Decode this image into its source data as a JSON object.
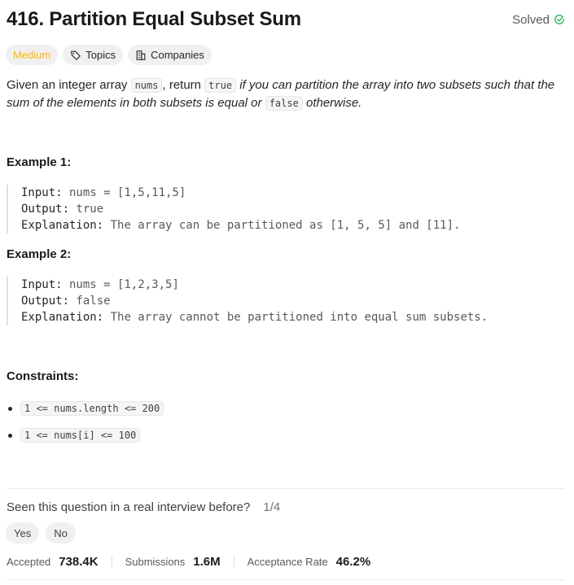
{
  "problem": {
    "title": "416. Partition Equal Subset Sum",
    "status": "Solved",
    "tags": {
      "difficulty": "Medium",
      "topics": "Topics",
      "companies": "Companies"
    }
  },
  "description": {
    "p1": "Given an integer array ",
    "code_nums": "nums",
    "p2": ", return ",
    "code_true": "true",
    "p3_italic": " if you can partition the array into two subsets such that the sum of the elements in both subsets is equal or ",
    "code_false": "false",
    "p4_italic": " otherwise."
  },
  "examples": [
    {
      "heading": "Example 1:",
      "input_label": "Input:",
      "input_value": " nums = [1,5,11,5]",
      "output_label": "Output:",
      "output_value": " true",
      "explanation_label": "Explanation:",
      "explanation_value": " The array can be partitioned as [1, 5, 5] and [11]."
    },
    {
      "heading": "Example 2:",
      "input_label": "Input:",
      "input_value": " nums = [1,2,3,5]",
      "output_label": "Output:",
      "output_value": " false",
      "explanation_label": "Explanation:",
      "explanation_value": " The array cannot be partitioned into equal sum subsets."
    }
  ],
  "constraints": {
    "heading": "Constraints:",
    "items": [
      "1 <= nums.length <= 200",
      "1 <= nums[i] <= 100"
    ]
  },
  "interview": {
    "question": "Seen this question in a real interview before?",
    "count": "1/4",
    "yes_label": "Yes",
    "no_label": "No"
  },
  "stats": {
    "accepted_label": "Accepted",
    "accepted_value": "738.4K",
    "submissions_label": "Submissions",
    "submissions_value": "1.6M",
    "rate_label": "Acceptance Rate",
    "rate_value": "46.2%"
  },
  "colors": {
    "medium": "#ffb800",
    "solved_check": "#2db55d"
  }
}
